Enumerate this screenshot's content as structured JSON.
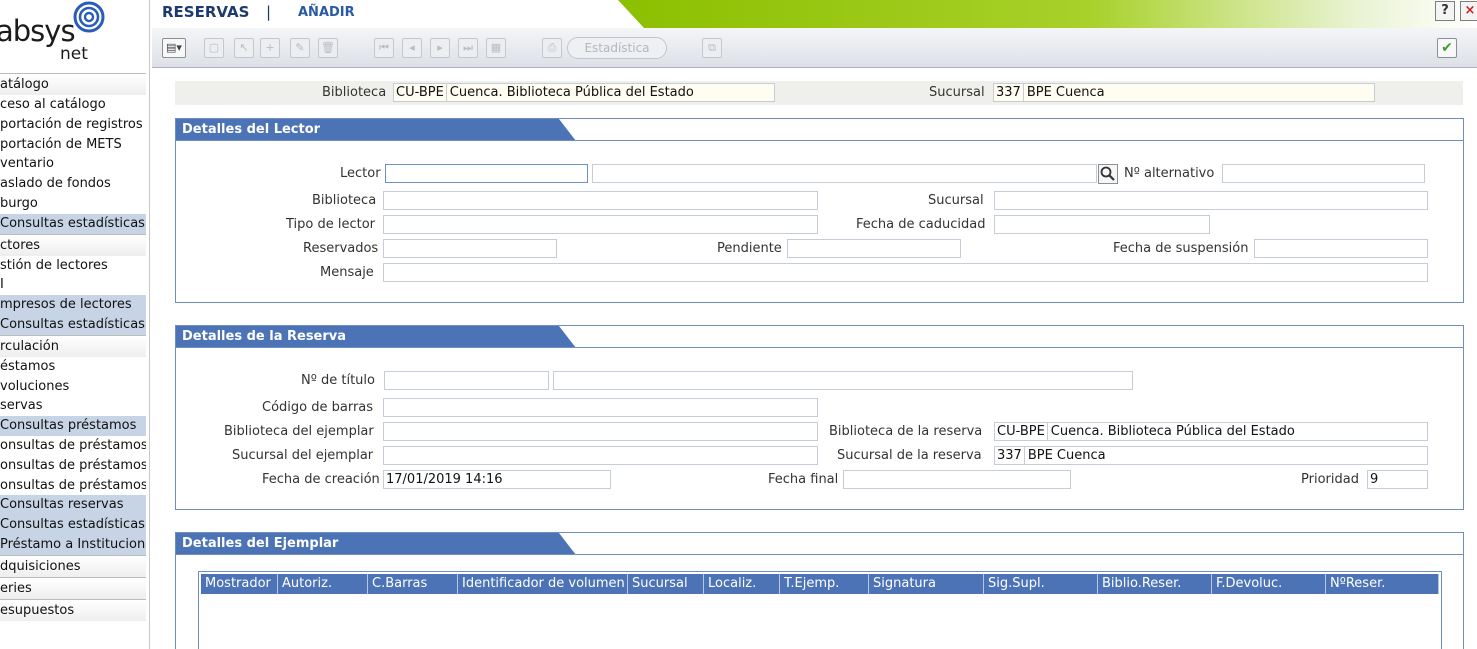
{
  "logo": {
    "text": "absys",
    "sub": "net"
  },
  "menu": [
    {
      "label": "atálogo",
      "kind": "cat"
    },
    {
      "label": "ceso al catálogo",
      "kind": "item"
    },
    {
      "label": "portación de registros",
      "kind": "item"
    },
    {
      "label": "portación de METS",
      "kind": "item"
    },
    {
      "label": "ventario",
      "kind": "item"
    },
    {
      "label": "aslado de fondos",
      "kind": "item"
    },
    {
      "label": "burgo",
      "kind": "item"
    },
    {
      "label": "Consultas estadísticas",
      "kind": "sub"
    },
    {
      "label": "ctores",
      "kind": "cat"
    },
    {
      "label": "stión de lectores",
      "kind": "item"
    },
    {
      "label": "I",
      "kind": "item"
    },
    {
      "label": "mpresos de lectores",
      "kind": "sub"
    },
    {
      "label": "Consultas estadísticas d",
      "kind": "sub"
    },
    {
      "label": "rculación",
      "kind": "cat"
    },
    {
      "label": "éstamos",
      "kind": "item"
    },
    {
      "label": "voluciones",
      "kind": "item"
    },
    {
      "label": "servas",
      "kind": "item"
    },
    {
      "label": "Consultas préstamos",
      "kind": "sub"
    },
    {
      "label": "onsultas de préstamos",
      "kind": "item"
    },
    {
      "label": "onsultas de préstamos",
      "kind": "item"
    },
    {
      "label": "onsultas de préstamos",
      "kind": "item"
    },
    {
      "label": "Consultas reservas",
      "kind": "sub"
    },
    {
      "label": "Consultas estadísticas",
      "kind": "sub"
    },
    {
      "label": "Préstamo a Institucione",
      "kind": "sub"
    },
    {
      "label": "dquisiciones",
      "kind": "cat"
    },
    {
      "label": "eries",
      "kind": "cat"
    },
    {
      "label": "esupuestos",
      "kind": "cat"
    }
  ],
  "header": {
    "title": "RESERVAS",
    "separator": "|",
    "action": "AÑADIR",
    "help": "?",
    "close": "×"
  },
  "toolbar": {
    "stats_label": "Estadística"
  },
  "library_bar": {
    "biblioteca_label": "Biblioteca",
    "biblioteca_code": "CU-BPE",
    "biblioteca_name": "Cuenca. Biblioteca Pública del Estado",
    "sucursal_label": "Sucursal",
    "sucursal_code": "337",
    "sucursal_name": "BPE Cuenca"
  },
  "lector": {
    "title": "Detalles del Lector",
    "lector_label": "Lector",
    "lector_code": "",
    "lector_name": "",
    "alt_label": "Nº alternativo",
    "alt_value": "",
    "biblioteca_label": "Biblioteca",
    "biblioteca_value": "",
    "sucursal_label": "Sucursal",
    "sucursal_value": "",
    "tipo_label": "Tipo de lector",
    "tipo_value": "",
    "caducidad_label": "Fecha de caducidad",
    "caducidad_value": "",
    "reservados_label": "Reservados",
    "reservados_value": "",
    "pendiente_label": "Pendiente",
    "pendiente_value": "",
    "suspension_label": "Fecha de suspensión",
    "suspension_value": "",
    "mensaje_label": "Mensaje",
    "mensaje_value": ""
  },
  "reserva": {
    "title": "Detalles de la Reserva",
    "titulo_label": "Nº de título",
    "titulo_code": "",
    "titulo_name": "",
    "barras_label": "Código de barras",
    "barras_value": "",
    "bib_ej_label": "Biblioteca del ejemplar",
    "bib_ej_value": "",
    "bib_res_label": "Biblioteca de la reserva",
    "bib_res_code": "CU-BPE",
    "bib_res_name": "Cuenca. Biblioteca Pública del Estado",
    "suc_ej_label": "Sucursal del ejemplar",
    "suc_ej_value": "",
    "suc_res_label": "Sucursal de la reserva",
    "suc_res_code": "337",
    "suc_res_name": "BPE Cuenca",
    "creacion_label": "Fecha de creación",
    "creacion_value": "17/01/2019 14:16",
    "final_label": "Fecha final",
    "final_value": "",
    "prioridad_label": "Prioridad",
    "prioridad_value": "9"
  },
  "ejemplar": {
    "title": "Detalles del Ejemplar",
    "columns": [
      "Mostrador",
      "Autoriz.",
      "C.Barras",
      "Identificador de volumen",
      "Sucursal",
      "Localiz.",
      "T.Ejemp.",
      "Signatura",
      "Sig.Supl.",
      "Biblio.Reser.",
      "F.Devoluc.",
      "NºReser."
    ]
  }
}
